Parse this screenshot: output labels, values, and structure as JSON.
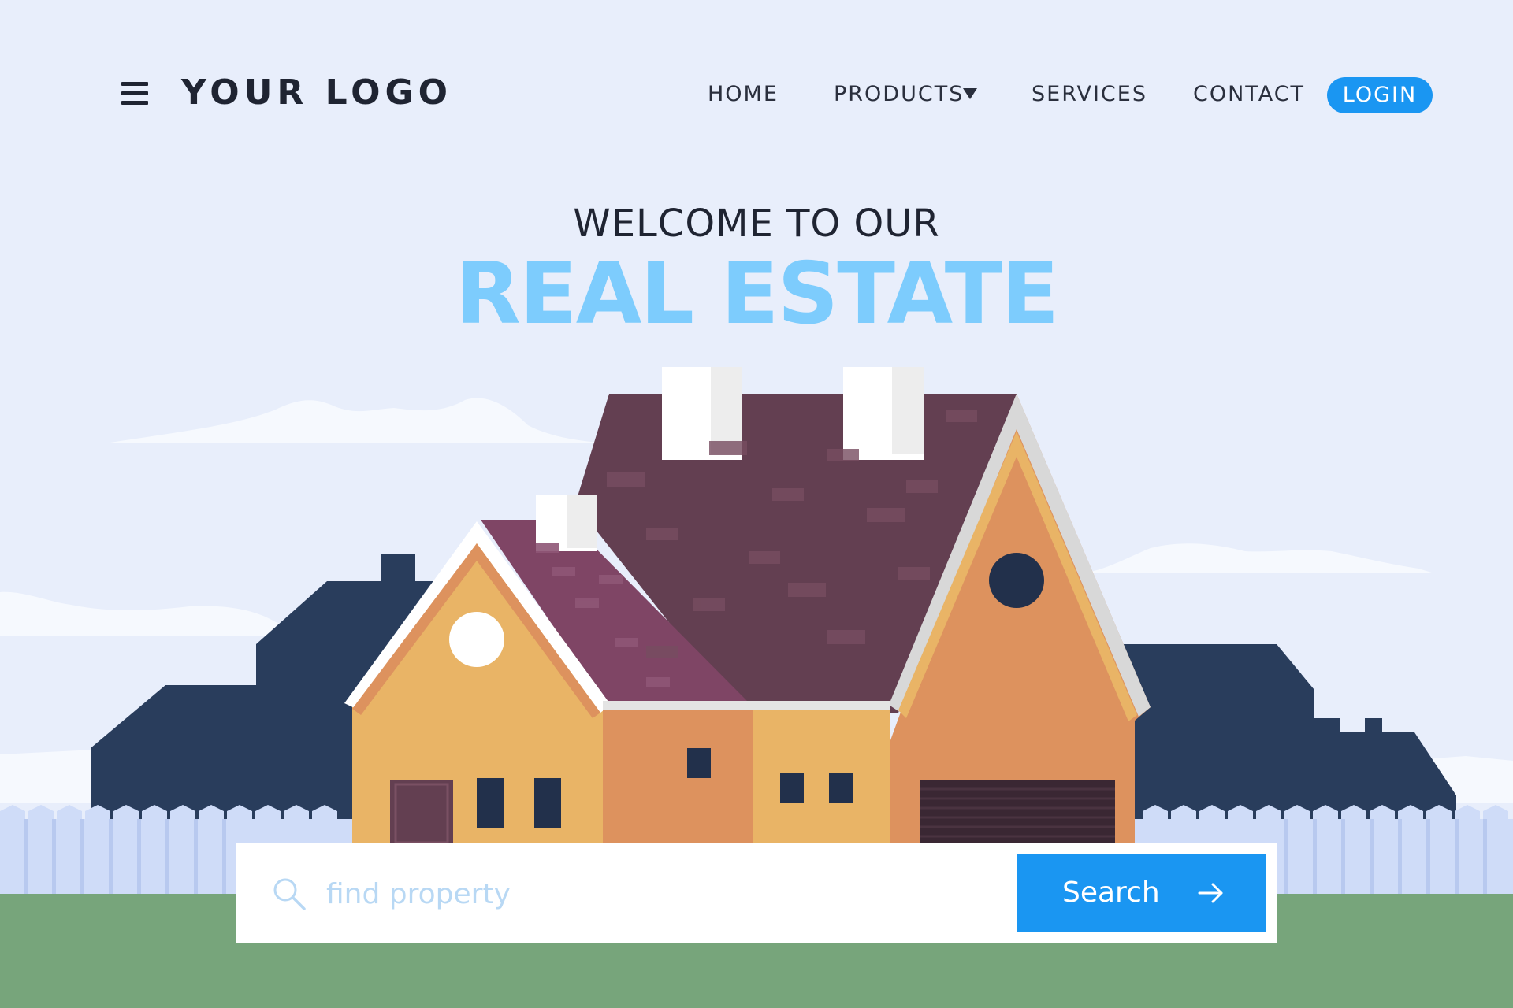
{
  "header": {
    "logo": "YOUR LOGO",
    "menu_icon": "hamburger-menu-icon",
    "nav": {
      "home": "HOME",
      "products": "PRODUCTS",
      "services": "SERVICES",
      "contact": "CONTACT"
    },
    "products_icon": "caret-down-icon",
    "login": "LOGIN"
  },
  "hero": {
    "welcome": "WELCOME TO OUR",
    "headline": "REAL ESTATE"
  },
  "search": {
    "icon": "search-icon",
    "placeholder": "find property",
    "button_label": "Search",
    "button_icon": "arrow-right-icon"
  },
  "colors": {
    "background": "#e8eefb",
    "accent": "#1a96f2",
    "headline": "#7dccfd",
    "text": "#1f2432",
    "grass": "#77a57b",
    "roof": "#633f51",
    "house_orange": "#dd925e",
    "house_yellow": "#e9b466",
    "silhouette": "#293d5c"
  }
}
